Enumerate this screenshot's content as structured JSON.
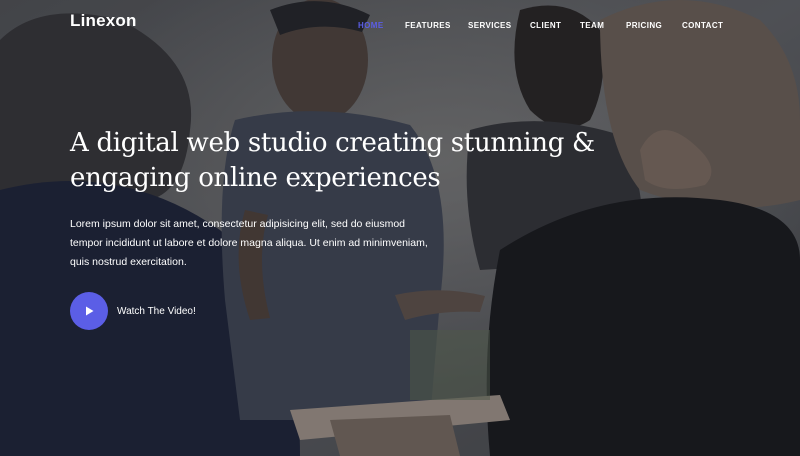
{
  "brand": {
    "logo": "Linexon"
  },
  "nav": {
    "active": "HOME",
    "items": [
      {
        "label": "HOME"
      },
      {
        "label": "FEATURES"
      },
      {
        "label": "SERVICES"
      },
      {
        "label": "CLIENT"
      },
      {
        "label": "TEAM"
      },
      {
        "label": "PRICING"
      },
      {
        "label": "CONTACT"
      }
    ]
  },
  "hero": {
    "headline": "A digital web studio creating stunning & engaging online experiences",
    "intro": "Lorem ipsum dolor sit amet, consectetur adipisicing elit, sed do eiusmod tempor incididunt ut labore et dolore magna aliqua. Ut enim ad minimveniam, quis nostrud exercitation.",
    "video": {
      "label": "Watch The Video!",
      "icon": "play-icon"
    },
    "background": "photo of a group of young people gathered around a table"
  },
  "colors": {
    "accent": "#5b5ee6",
    "text": "#ffffff",
    "overlay": "#6f7073"
  }
}
